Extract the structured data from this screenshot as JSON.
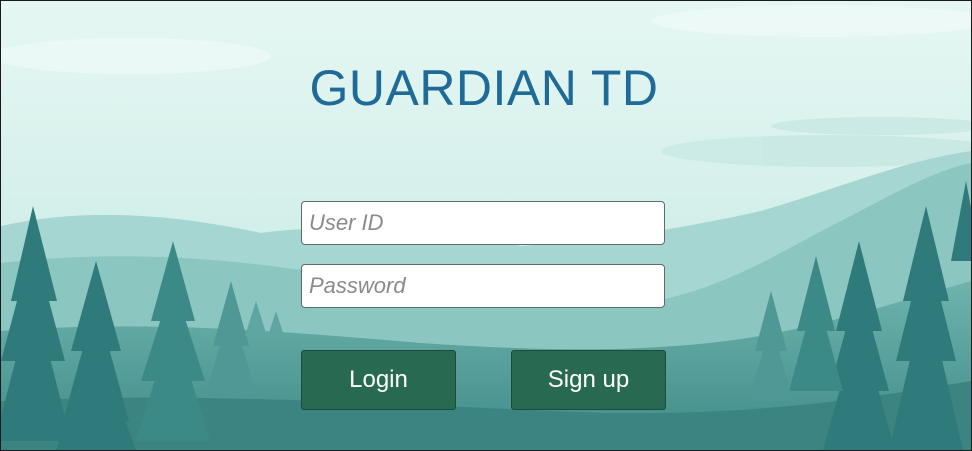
{
  "app": {
    "title": "GUARDIAN TD"
  },
  "form": {
    "user_id_placeholder": "User ID",
    "user_id_value": "",
    "password_placeholder": "Password",
    "password_value": ""
  },
  "buttons": {
    "login_label": "Login",
    "signup_label": "Sign up"
  },
  "colors": {
    "title": "#1f6a96",
    "button_bg": "#286a51",
    "sky": "#dff3ef",
    "trees": "#2e7a7c"
  },
  "background": {
    "scene": "misty-mountains-pine-forest"
  }
}
